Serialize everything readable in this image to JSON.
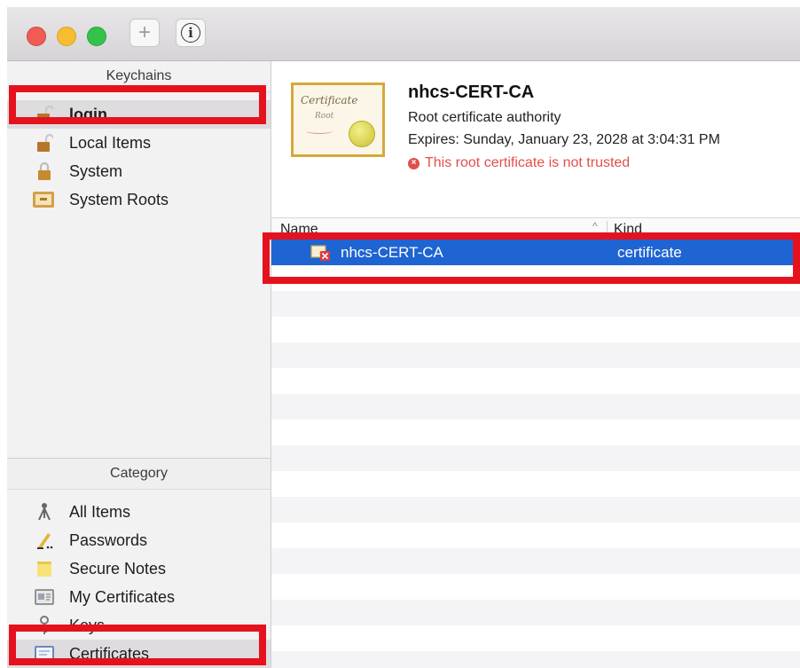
{
  "toolbar": {
    "add_label": "+",
    "info_label": "i"
  },
  "sidebar": {
    "keychains_header": "Keychains",
    "keychains": [
      {
        "label": "login",
        "icon": "lock-open-icon"
      },
      {
        "label": "Local Items",
        "icon": "lock-open-icon"
      },
      {
        "label": "System",
        "icon": "lock-icon"
      },
      {
        "label": "System Roots",
        "icon": "cabinet-icon"
      }
    ],
    "category_header": "Category",
    "categories": [
      {
        "label": "All Items",
        "icon": "all-items-icon"
      },
      {
        "label": "Passwords",
        "icon": "pen-icon"
      },
      {
        "label": "Secure Notes",
        "icon": "note-icon"
      },
      {
        "label": "My Certificates",
        "icon": "id-card-icon"
      },
      {
        "label": "Keys",
        "icon": "key-icon"
      },
      {
        "label": "Certificates",
        "icon": "certificate-icon"
      }
    ]
  },
  "detail": {
    "thumb_script": "Certificate",
    "thumb_script2": "Root",
    "title": "nhcs-CERT-CA",
    "subtitle": "Root certificate authority",
    "expires": "Expires: Sunday, January 23, 2028 at 3:04:31 PM",
    "warning": "This root certificate is not trusted",
    "warning_glyph": "×"
  },
  "table": {
    "columns": {
      "name": "Name",
      "kind": "Kind",
      "sort_glyph": "^"
    },
    "rows": [
      {
        "name": "nhcs-CERT-CA",
        "kind": "certificate",
        "selected": true
      }
    ]
  },
  "colors": {
    "highlight": "#e5121e",
    "selection": "#1e64d2",
    "warning": "#e0504a"
  }
}
